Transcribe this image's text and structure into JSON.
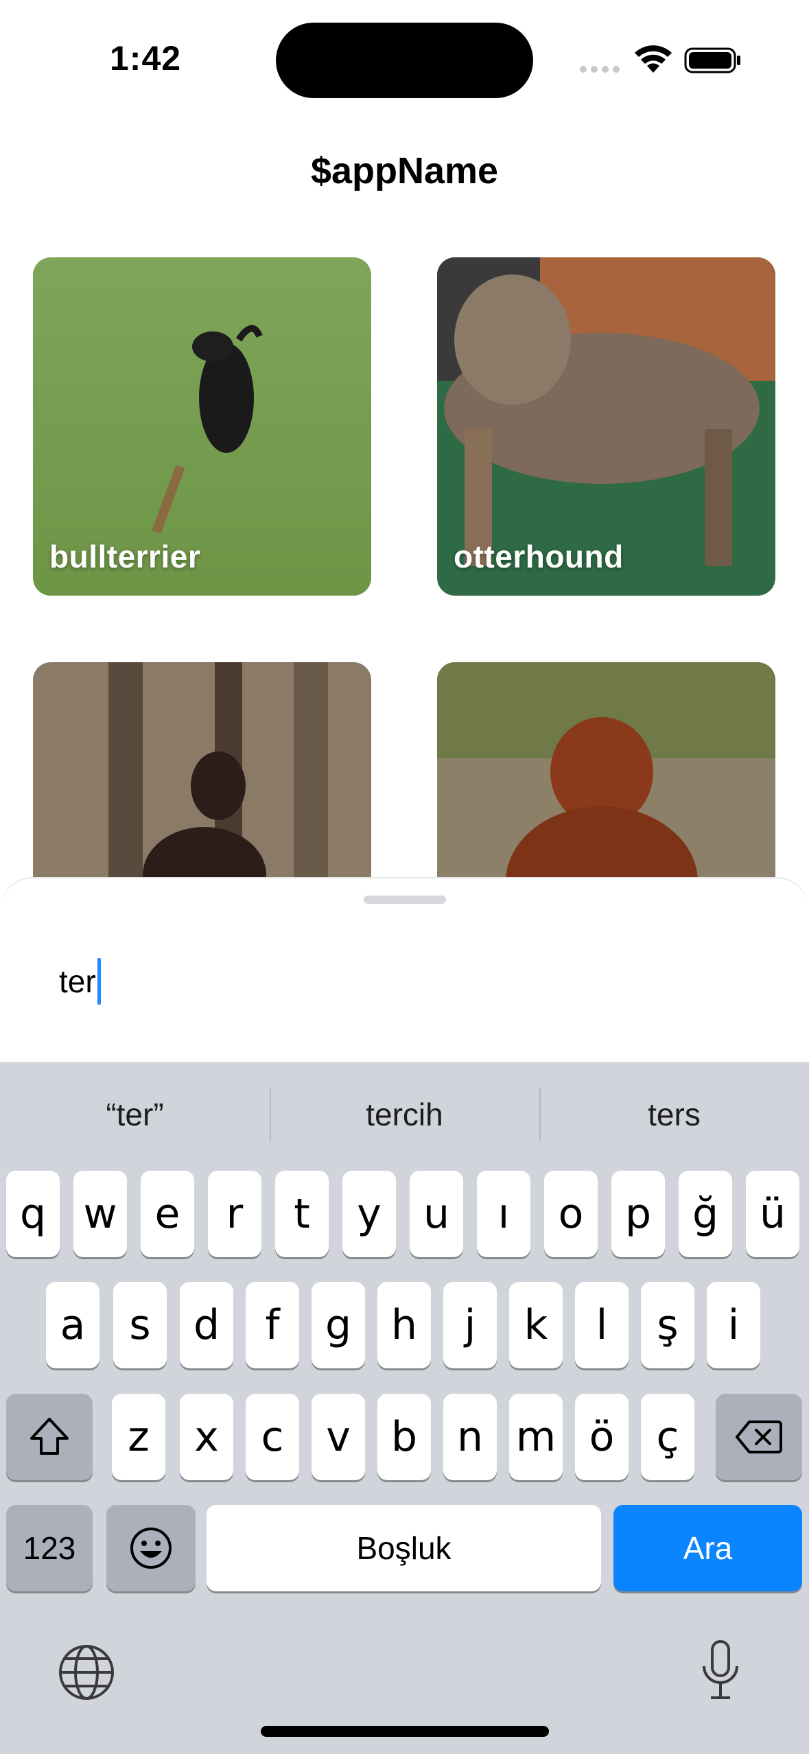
{
  "status_bar": {
    "time": "1:42"
  },
  "header": {
    "title": "$appName"
  },
  "cards": [
    {
      "label": "bullterrier"
    },
    {
      "label": "otterhound"
    },
    {
      "label": ""
    },
    {
      "label": ""
    }
  ],
  "search": {
    "value": "ter"
  },
  "keyboard": {
    "suggestions": [
      "“ter”",
      "tercih",
      "ters"
    ],
    "row1": [
      "q",
      "w",
      "e",
      "r",
      "t",
      "y",
      "u",
      "ı",
      "o",
      "p",
      "ğ",
      "ü"
    ],
    "row2": [
      "a",
      "s",
      "d",
      "f",
      "g",
      "h",
      "j",
      "k",
      "l",
      "ş",
      "i"
    ],
    "row3": [
      "z",
      "x",
      "c",
      "v",
      "b",
      "n",
      "m",
      "ö",
      "ç"
    ],
    "numbers_label": "123",
    "space_label": "Boşluk",
    "return_label": "Ara"
  }
}
